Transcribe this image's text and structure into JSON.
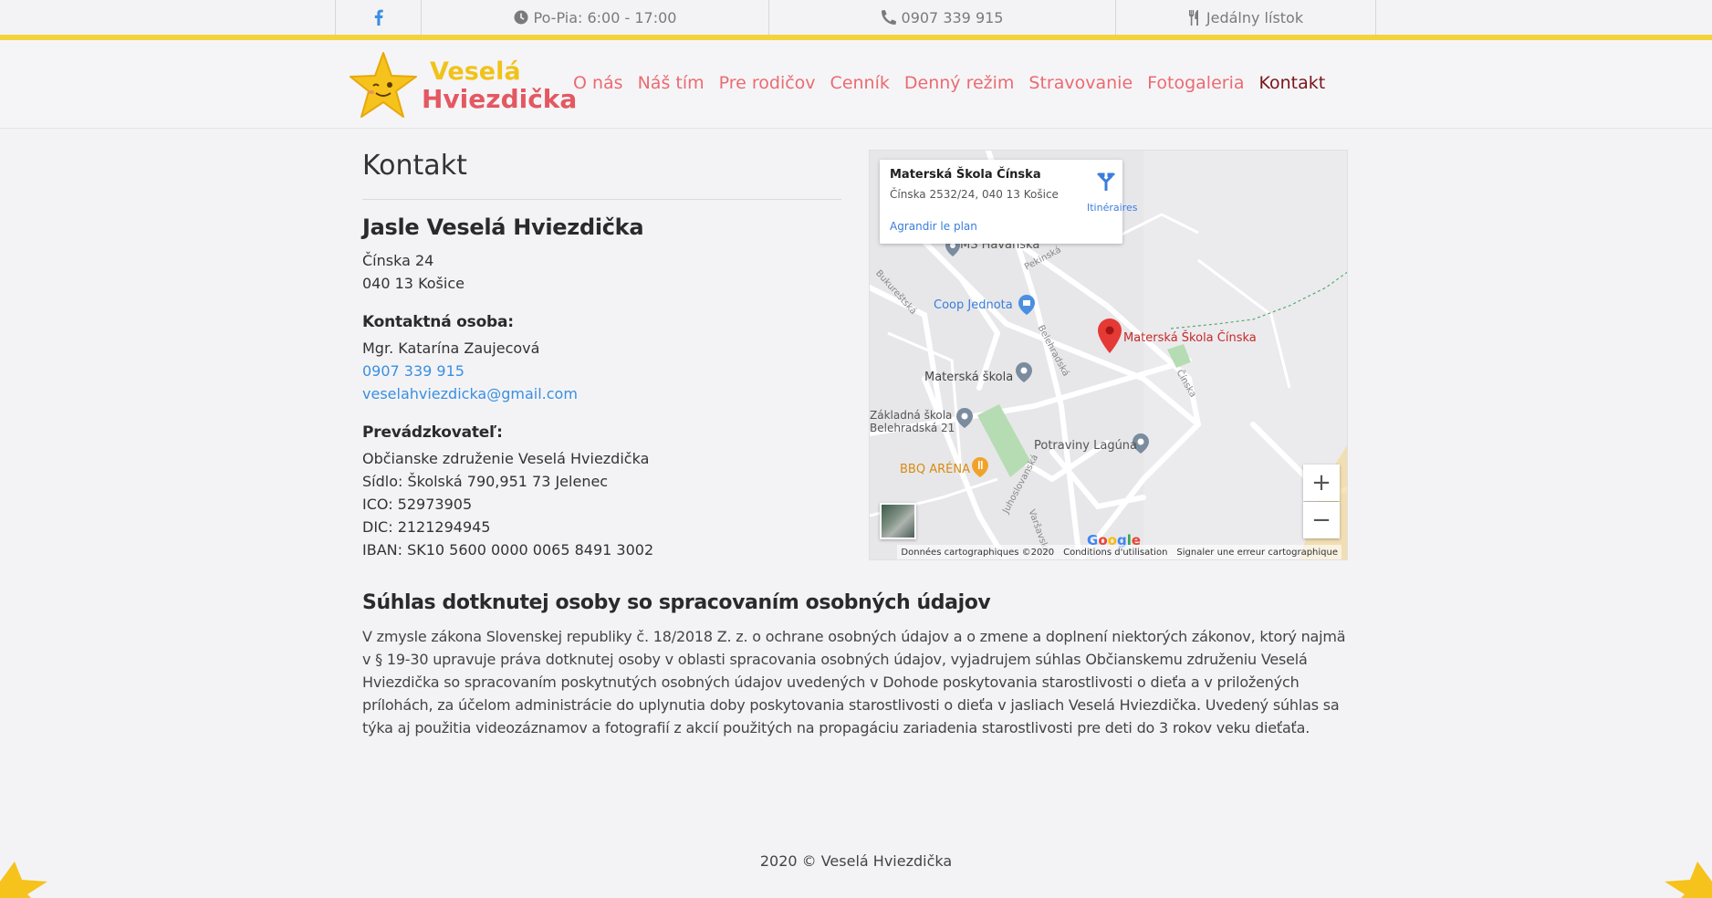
{
  "topbar": {
    "facebook_icon": "facebook-icon",
    "hours": "Po-Pia: 6:00 - 17:00",
    "phone": "0907 339 915",
    "menu": "Jedálny lístok"
  },
  "logo": {
    "line1": "Veselá",
    "line2": "Hviezdička"
  },
  "nav": [
    {
      "label": "O nás"
    },
    {
      "label": "Náš tím"
    },
    {
      "label": "Pre rodičov"
    },
    {
      "label": "Cenník"
    },
    {
      "label": "Denný režim"
    },
    {
      "label": "Stravovanie"
    },
    {
      "label": "Fotogaleria"
    },
    {
      "label": "Kontakt"
    }
  ],
  "contact": {
    "title": "Kontakt",
    "org_name": "Jasle Veselá Hviezdička",
    "address": [
      "Čínska 24",
      "040 13 Košice"
    ],
    "person_heading": "Kontaktná osoba:",
    "person_name": "Mgr. Katarína Zaujecová",
    "phone": "0907 339 915",
    "email": "veselahviezdicka@gmail.com",
    "operator_heading": "Prevádzkovateľ:",
    "operator_lines": [
      "Občianske združenie Veselá Hviezdička",
      "Sídlo: Školská 790,951 73 Jelenec",
      "ICO: 52973905",
      "DIC: 2121294945",
      "IBAN: SK10 5600 0000 0065 8491 3002"
    ]
  },
  "consent": {
    "title": "Súhlas dotknutej osoby so spracovaním osobných údajov",
    "text": "V zmysle zákona Slovenskej republiky č. 18/2018 Z. z. o ochrane osobných údajov a o zmene a doplnení niektorých zákonov, ktorý najmä v § 19-30 upravuje práva dotknutej osoby v oblasti spracovania osobných údajov, vyjadrujem súhlas Občianskemu združeniu Veselá Hviezdička so spracovaním poskytnutých osobných údajov uvedených v Dohode poskytovania starostlivosti o dieťa a v priložených prílohách, za účelom administrácie do uplynutia doby poskytovania starostlivosti o dieťa v jasliach Veselá Hviezdička. Uvedený súhlas sa týka aj použitia videozáznamov a fotografií z akcií použitých na propagáciu zariadenia starostlivosti pre deti do 3 rokov veku dieťaťa."
  },
  "map": {
    "place_name": "Materská Škola Čínska",
    "place_address": "Čínska 2532/24, 040 13 Košice",
    "directions": "Itinéraires",
    "enlarge": "Agrandir le plan",
    "labels": {
      "ms_havanska": "MŠ Havanská",
      "coop": "Coop Jednota",
      "marker": "Materská Škola Čínska",
      "materska": "Materská škola",
      "zakladna1": "Základná škola",
      "zakladna2": "Belehradská 21",
      "potraviny": "Potraviny Lagúna",
      "bbq": "BBQ ARÉNA",
      "st_pekinska": "Pekinská",
      "st_belehradska": "Belehradská",
      "st_cinska": "Čínska",
      "st_jukoslovanska": "Juhoslovanská",
      "st_varsavska": "Varšavská",
      "st_bukurestska": "Bukureštská"
    },
    "zoom_in": "+",
    "zoom_out": "−",
    "google": [
      "G",
      "o",
      "o",
      "g",
      "l",
      "e"
    ],
    "footer_data": "Données cartographiques ©2020",
    "footer_terms": "Conditions d'utilisation",
    "footer_report": "Signaler une erreur cartographique"
  },
  "footer": {
    "text": "2020 © Veselá Hviezdička"
  },
  "colors": {
    "accent_yellow": "#f2d33c",
    "nav_pink": "#ec6a72",
    "nav_active": "#7a1418",
    "link_blue": "#3a8fe0"
  }
}
